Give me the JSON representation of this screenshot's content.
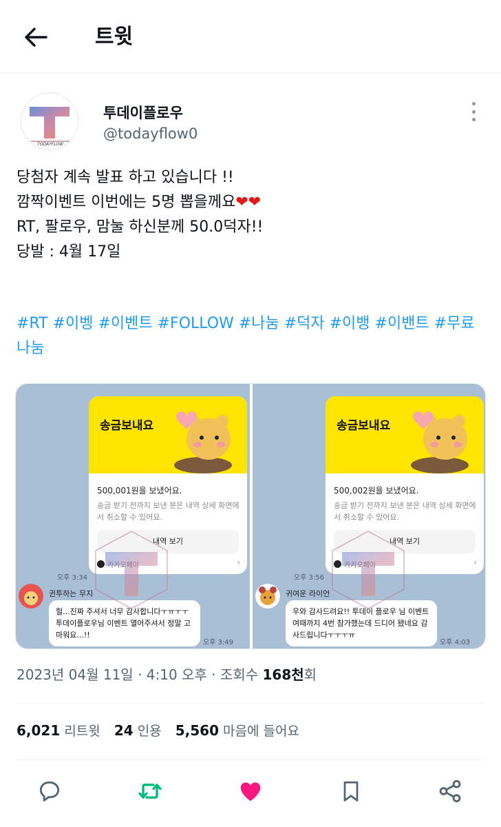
{
  "header": {
    "title": "트윗"
  },
  "author": {
    "name": "투데이플로우",
    "handle": "@todayflow0",
    "logo_text": "TODAYFLOW"
  },
  "tweet": {
    "lines": [
      "당첨자 계속 발표 하고 있습니다 !!",
      "깜짝이벤트 이번에는 5명 뽑을께요",
      "RT, 팔로우, 맘눌 하신분께 50.0덕자!!",
      "",
      "당발 : 4월 17일"
    ],
    "hearts": "❤❤",
    "hashtags": "#RT #이벵 #이벤트 #FOLLOW #나눔 #덕자 #이뱅 #이밴트 #무료나눔"
  },
  "media": {
    "left": {
      "card_title": "송금보내요",
      "amount": "500,001원을 보냈어요.",
      "note": "송금 받기 전까지 보낸 분은 내역 상세 화면에서 취소할 수 있어요.",
      "button": "내역 보기",
      "pay": "카카오페이",
      "time_sent": "오후 3:34",
      "sender": "귄투하는 무지",
      "message": "헐...진짜 주셔서 너무 감사합니다ㅜㅠㅜㅜ 투데이플로우님 이벤트 열어주셔서 정말 고마워요...!!",
      "time_reply": "오후 3:49"
    },
    "right": {
      "card_title": "송금보내요",
      "amount": "500,002원을 보냈어요.",
      "note": "송금 받기 전까지 보낸 분은 내역 상세 화면에서 취소할 수 있어요.",
      "button": "내역 보기",
      "pay": "카카오페이",
      "time_sent": "오후 3:56",
      "sender": "귀여운 라이언",
      "message": "우와 감사드려요!! 투데이 플로우 님 이벤트 여때까지 4번 참가했는데 드디어 됐네요 감사드립니다ㅜㅜㅜㅠ",
      "time_reply": "오후 4:03"
    }
  },
  "meta": {
    "date_time": "2023년 04월 11일 · 4:10 오후 · 조회수 ",
    "views": "168천",
    "views_suffix": "회"
  },
  "stats": {
    "retweets_count": "6,021",
    "retweets_label": "리트윗",
    "quotes_count": "24",
    "quotes_label": "인용",
    "likes_count": "5,560",
    "likes_label": "마음에 들어요"
  },
  "colors": {
    "link": "#1d9bf0",
    "retweet": "#00ba7c",
    "like": "#f91880",
    "muted": "#536471"
  },
  "icons": [
    "back-arrow-icon",
    "more-icon",
    "reply-icon",
    "retweet-icon",
    "like-icon",
    "bookmark-icon",
    "share-icon"
  ]
}
